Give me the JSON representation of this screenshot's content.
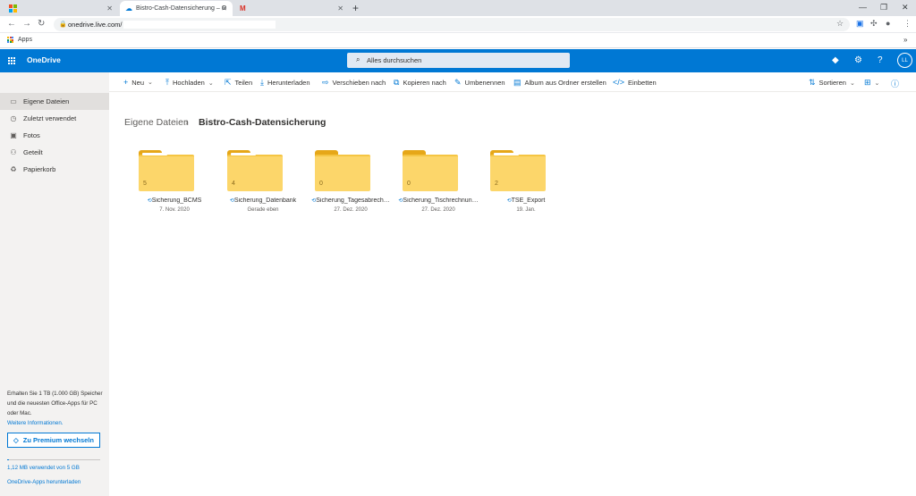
{
  "browser": {
    "tabs": [
      {
        "title": "",
        "active": false
      },
      {
        "title": "Bistro-Cash-Datensicherung – O",
        "active": true
      },
      {
        "title": "",
        "active": false
      }
    ],
    "new_tab": "+",
    "url": "onedrive.live.com/",
    "bookmarks_apps": "Apps",
    "bookmarks_more": "»"
  },
  "suite": {
    "brand": "OneDrive",
    "search_placeholder": "Alles durchsuchen",
    "avatar_initials": "LL"
  },
  "nav": {
    "items": [
      {
        "label": "Eigene Dateien",
        "icon": "folder-icon",
        "selected": true
      },
      {
        "label": "Zuletzt verwendet",
        "icon": "clock-icon",
        "selected": false
      },
      {
        "label": "Fotos",
        "icon": "photo-icon",
        "selected": false
      },
      {
        "label": "Geteilt",
        "icon": "share-icon",
        "selected": false
      },
      {
        "label": "Papierkorb",
        "icon": "recycle-bin-icon",
        "selected": false
      }
    ],
    "promo_text": "Erhalten Sie 1 TB (1.000 GB) Speicher und die neuesten Office-Apps für PC oder Mac.",
    "promo_link": "Weitere Informationen.",
    "premium_button": "Zu Premium wechseln",
    "storage_text": "1,12 MB verwendet von 5 GB",
    "storage_fraction": 0.0002,
    "get_apps": "OneDrive-Apps herunterladen"
  },
  "commands": {
    "new": "Neu",
    "upload": "Hochladen",
    "share": "Teilen",
    "download": "Herunterladen",
    "move": "Verschieben nach",
    "copy": "Kopieren nach",
    "rename": "Umbenennen",
    "album": "Album aus Ordner erstellen",
    "embed": "Einbetten",
    "sort": "Sortieren"
  },
  "breadcrumb": {
    "root": "Eigene Dateien",
    "separator": "›",
    "current": "Bistro-Cash-Datensicherung"
  },
  "folders": [
    {
      "name": "Sicherung_BCMS",
      "count": "5",
      "date": "7. Nov. 2020"
    },
    {
      "name": "Sicherung_Datenbank",
      "count": "4",
      "date": "Gerade eben"
    },
    {
      "name": "Sicherung_Tagesabrech…",
      "count": "0",
      "date": "27. Dez. 2020"
    },
    {
      "name": "Sicherung_Tischrechnun…",
      "count": "0",
      "date": "27. Dez. 2020"
    },
    {
      "name": "TSE_Export",
      "count": "2",
      "date": "19. Jan."
    }
  ],
  "colors": {
    "accent": "#0078d4",
    "folder": "#fcd66a",
    "folder_tab": "#e6a718"
  }
}
